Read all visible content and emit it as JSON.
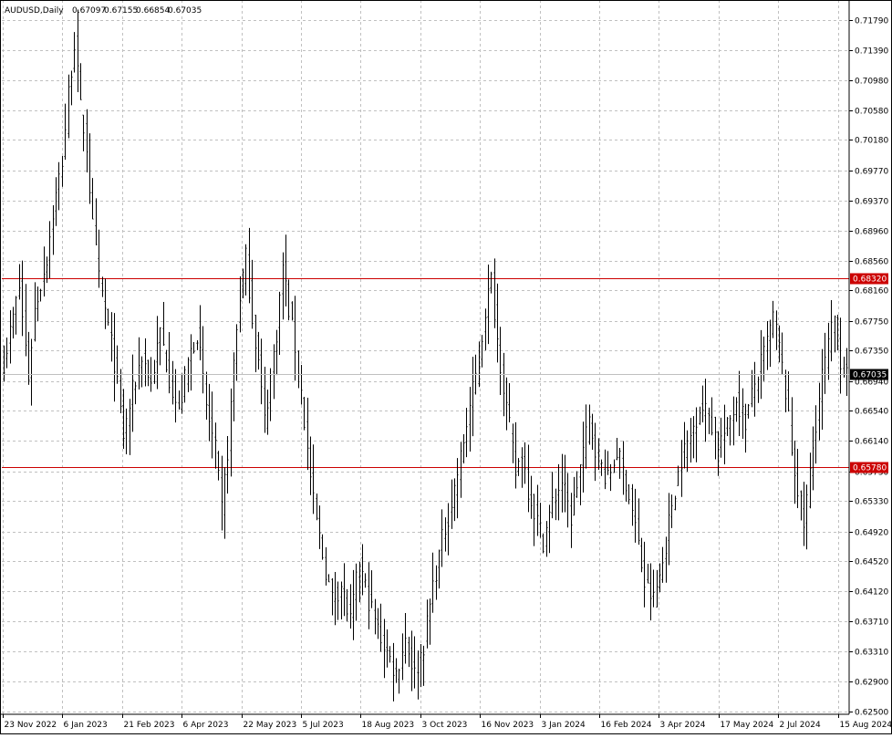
{
  "header": {
    "symbol": "AUDUSD,Daily",
    "open": "0.67097",
    "high": "0.67155",
    "low": "0.66854",
    "close": "0.67035"
  },
  "colors": {
    "background": "#ffffff",
    "bars": "#000000",
    "grid": "#c0c0c0",
    "hline": "#cc0000",
    "last_price_bg": "#000000"
  },
  "chart_data": {
    "type": "ohlc",
    "grid": true,
    "ylim": [
      0.625,
      0.72
    ],
    "y_ticks": [
      "0.71790",
      "0.71390",
      "0.70980",
      "0.70580",
      "0.70180",
      "0.69770",
      "0.69370",
      "0.68960",
      "0.68560",
      "0.68160",
      "0.67750",
      "0.67350",
      "0.66940",
      "0.66540",
      "0.66140",
      "0.65730",
      "0.65330",
      "0.64920",
      "0.64520",
      "0.64120",
      "0.63710",
      "0.63310",
      "0.62900",
      "0.62500"
    ],
    "x_labels": [
      "23 Nov 2022",
      "6 Jan 2023",
      "21 Feb 2023",
      "6 Apr 2023",
      "22 May 2023",
      "5 Jul 2023",
      "18 Aug 2023",
      "3 Oct 2023",
      "16 Nov 2023",
      "3 Jan 2024",
      "16 Feb 2024",
      "3 Apr 2024",
      "17 May 2024",
      "2 Jul 2024",
      "15 Aug 2024"
    ],
    "horizontal_lines": [
      {
        "value": 0.6832,
        "label": "0.68320"
      },
      {
        "value": 0.6578,
        "label": "0.65780"
      }
    ],
    "last_price": {
      "value": 0.67035,
      "label": "0.67035"
    },
    "close_path": [
      [
        0,
        0.672
      ],
      [
        5,
        0.682
      ],
      [
        8,
        0.67
      ],
      [
        10,
        0.679
      ],
      [
        14,
        0.686
      ],
      [
        16,
        0.692
      ],
      [
        19,
        0.699
      ],
      [
        21,
        0.708
      ],
      [
        23,
        0.715
      ],
      [
        25,
        0.706
      ],
      [
        27,
        0.701
      ],
      [
        29,
        0.69
      ],
      [
        31,
        0.683
      ],
      [
        33,
        0.679
      ],
      [
        36,
        0.672
      ],
      [
        39,
        0.662
      ],
      [
        42,
        0.668
      ],
      [
        45,
        0.673
      ],
      [
        48,
        0.669
      ],
      [
        51,
        0.676
      ],
      [
        54,
        0.67
      ],
      [
        57,
        0.665
      ],
      [
        60,
        0.672
      ],
      [
        63,
        0.676
      ],
      [
        66,
        0.666
      ],
      [
        69,
        0.66
      ],
      [
        71,
        0.652
      ],
      [
        73,
        0.66
      ],
      [
        75,
        0.672
      ],
      [
        77,
        0.681
      ],
      [
        79,
        0.686
      ],
      [
        81,
        0.678
      ],
      [
        83,
        0.672
      ],
      [
        85,
        0.664
      ],
      [
        87,
        0.67
      ],
      [
        89,
        0.676
      ],
      [
        91,
        0.685
      ],
      [
        93,
        0.679
      ],
      [
        95,
        0.674
      ],
      [
        97,
        0.668
      ],
      [
        99,
        0.66
      ],
      [
        101,
        0.653
      ],
      [
        104,
        0.646
      ],
      [
        107,
        0.64
      ],
      [
        110,
        0.642
      ],
      [
        113,
        0.637
      ],
      [
        116,
        0.645
      ],
      [
        119,
        0.64
      ],
      [
        122,
        0.636
      ],
      [
        125,
        0.633
      ],
      [
        128,
        0.63
      ],
      [
        131,
        0.635
      ],
      [
        134,
        0.63
      ],
      [
        137,
        0.634
      ],
      [
        140,
        0.642
      ],
      [
        143,
        0.648
      ],
      [
        146,
        0.653
      ],
      [
        149,
        0.659
      ],
      [
        152,
        0.666
      ],
      [
        155,
        0.672
      ],
      [
        157,
        0.679
      ],
      [
        159,
        0.683
      ],
      [
        161,
        0.675
      ],
      [
        163,
        0.669
      ],
      [
        165,
        0.663
      ],
      [
        167,
        0.657
      ],
      [
        169,
        0.66
      ],
      [
        171,
        0.655
      ],
      [
        173,
        0.652
      ],
      [
        176,
        0.648
      ],
      [
        179,
        0.653
      ],
      [
        182,
        0.656
      ],
      [
        185,
        0.651
      ],
      [
        188,
        0.658
      ],
      [
        191,
        0.664
      ],
      [
        194,
        0.659
      ],
      [
        197,
        0.656
      ],
      [
        200,
        0.66
      ],
      [
        203,
        0.656
      ],
      [
        206,
        0.65
      ],
      [
        209,
        0.642
      ],
      [
        212,
        0.64
      ],
      [
        215,
        0.645
      ],
      [
        218,
        0.653
      ],
      [
        221,
        0.659
      ],
      [
        224,
        0.662
      ],
      [
        227,
        0.666
      ],
      [
        230,
        0.665
      ],
      [
        233,
        0.661
      ],
      [
        236,
        0.663
      ],
      [
        239,
        0.667
      ],
      [
        242,
        0.664
      ],
      [
        245,
        0.669
      ],
      [
        248,
        0.673
      ],
      [
        251,
        0.678
      ],
      [
        253,
        0.674
      ],
      [
        255,
        0.668
      ],
      [
        257,
        0.66
      ],
      [
        259,
        0.655
      ],
      [
        261,
        0.65
      ],
      [
        263,
        0.657
      ],
      [
        265,
        0.664
      ],
      [
        267,
        0.67
      ],
      [
        269,
        0.674
      ],
      [
        271,
        0.678
      ],
      [
        273,
        0.672
      ],
      [
        275,
        0.67
      ]
    ],
    "bar_count": 276
  }
}
